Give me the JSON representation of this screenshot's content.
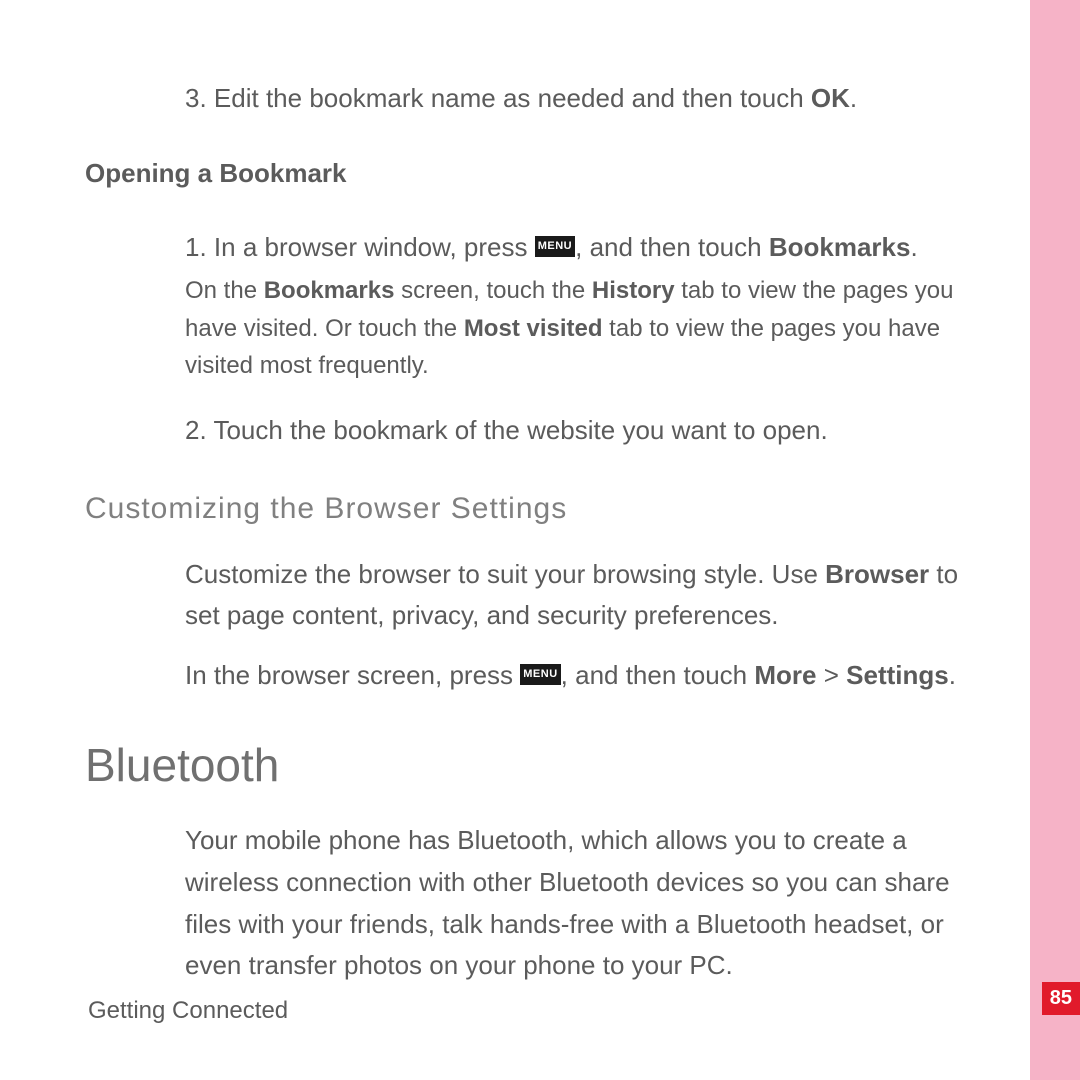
{
  "item3": {
    "num": "3. ",
    "t1": "Edit the bookmark name as needed and then touch ",
    "ok": "OK",
    "t2": "."
  },
  "h_opening": "Opening a Bookmark",
  "open1": {
    "num": "1. ",
    "t1": "In a browser window, press ",
    "menu": "MENU",
    "t2": ", and then touch ",
    "b1": "Bookmarks",
    "t3": ".",
    "note_t1": "On the ",
    "note_b1": "Bookmarks",
    "note_t2": " screen, touch the ",
    "note_b2": "History",
    "note_t3": " tab to view the pages you have visited. Or touch the ",
    "note_b3": "Most visited",
    "note_t4": " tab to view the pages you have visited most frequently."
  },
  "open2": {
    "num": "2. ",
    "t1": "Touch the bookmark of the website you want to open."
  },
  "h_custom": "Customizing  the  Browser  Settings",
  "custom_p1": {
    "t1": "Customize the browser to suit your browsing style. Use ",
    "b1": "Browser",
    "t2": " to set page content, privacy, and security preferences."
  },
  "custom_p2": {
    "t1": "In the browser screen, press ",
    "menu": "MENU",
    "t2": ", and then touch ",
    "b1": "More",
    "t3": " > ",
    "b2": "Settings",
    "t4": "."
  },
  "h_bluetooth": "Bluetooth",
  "bt_para": "Your mobile phone has Bluetooth, which allows you to create a wireless connection with other Bluetooth devices so you can share files with your friends, talk hands-free with a Bluetooth headset, or even transfer photos on your phone to your PC.",
  "footer": "Getting Connected",
  "page_num": "85"
}
